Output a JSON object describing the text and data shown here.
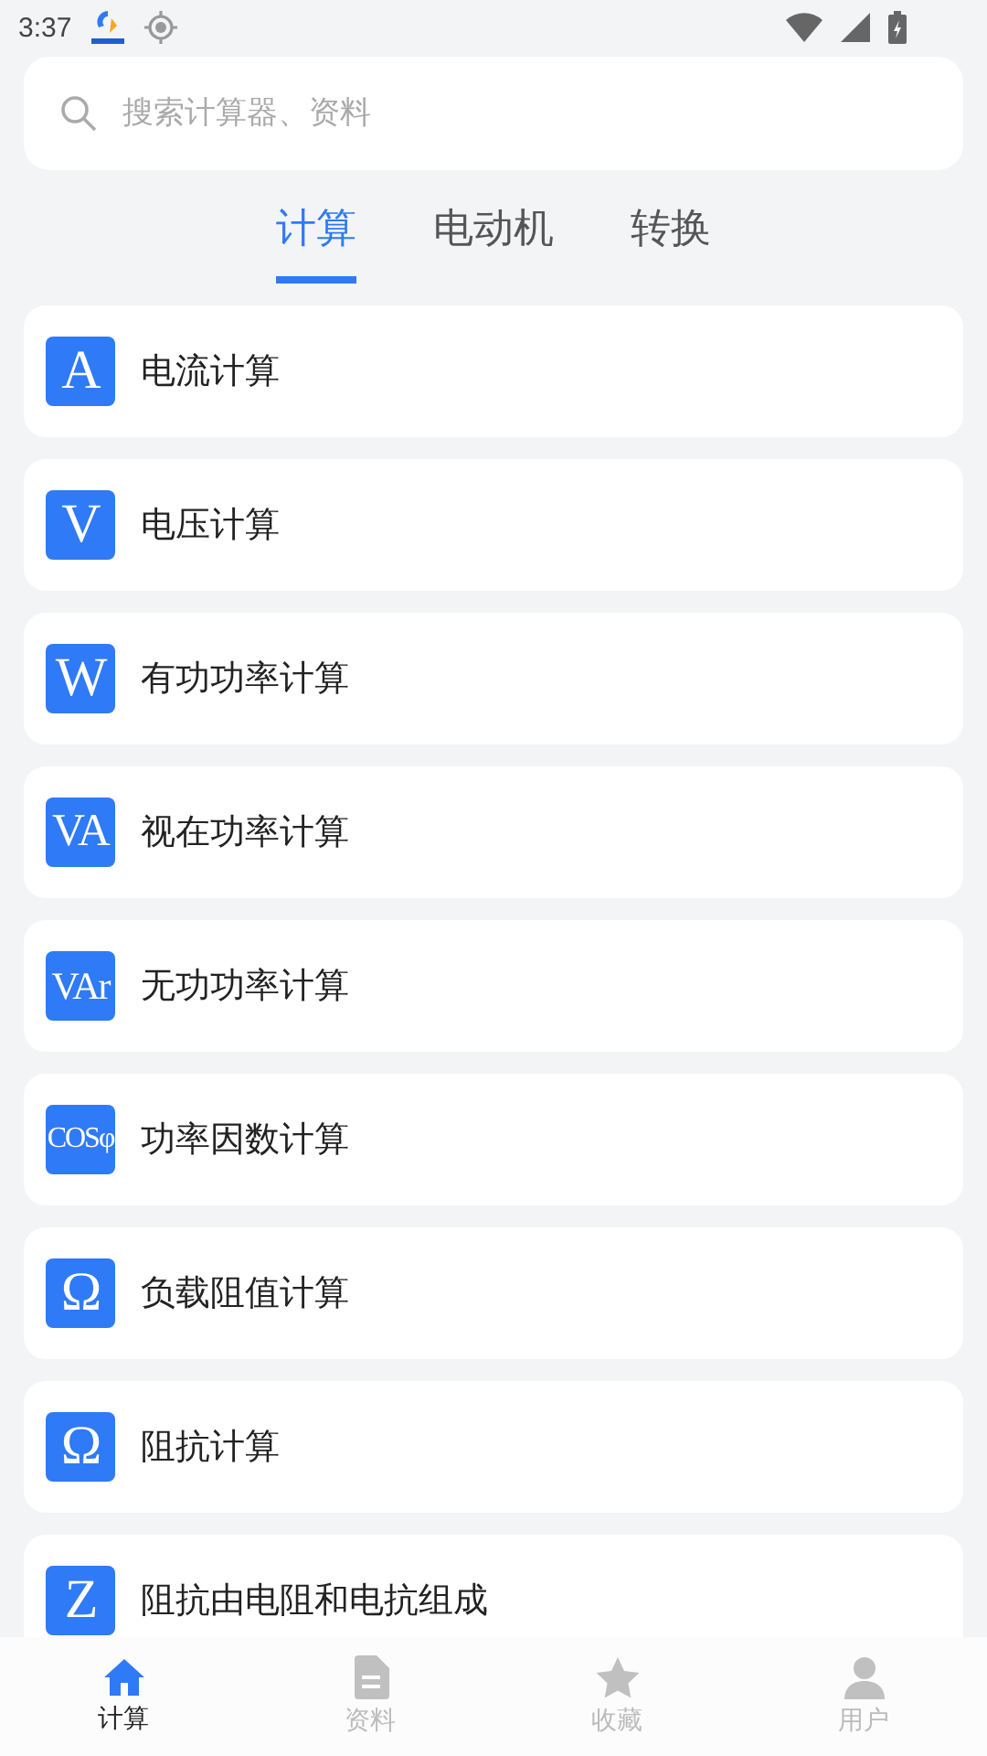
{
  "status_bar": {
    "time": "3:37"
  },
  "search": {
    "placeholder": "搜索计算器、资料"
  },
  "tabs": [
    {
      "label": "计算",
      "selected": true
    },
    {
      "label": "电动机",
      "selected": false
    },
    {
      "label": "转换",
      "selected": false
    }
  ],
  "items": [
    {
      "symbol": "A",
      "label": "电流计算"
    },
    {
      "symbol": "V",
      "label": "电压计算"
    },
    {
      "symbol": "W",
      "label": "有功功率计算"
    },
    {
      "symbol": "VA",
      "label": "视在功率计算"
    },
    {
      "symbol": "VAr",
      "label": "无功功率计算"
    },
    {
      "symbol": "COSφ",
      "label": "功率因数计算"
    },
    {
      "symbol": "Ω",
      "label": "负载阻值计算"
    },
    {
      "symbol": "Ω",
      "label": "阻抗计算"
    },
    {
      "symbol": "Z",
      "label": "阻抗由电阻和电抗组成"
    }
  ],
  "bottom_nav": [
    {
      "kind": "home",
      "label": "计算",
      "selected": true
    },
    {
      "kind": "document",
      "label": "资料",
      "selected": false
    },
    {
      "kind": "star",
      "label": "收藏",
      "selected": false
    },
    {
      "kind": "user",
      "label": "用户",
      "selected": false
    }
  ]
}
